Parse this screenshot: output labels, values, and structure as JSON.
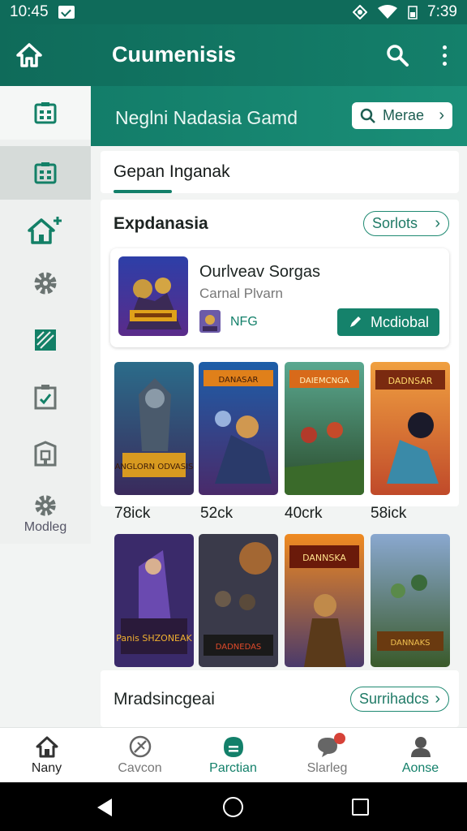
{
  "status_bar": {
    "time_left": "10:45",
    "time_right": "7:39"
  },
  "app_bar": {
    "title": "Cuumenisis",
    "icons": [
      "home-back-icon",
      "search-icon",
      "more-vert-icon"
    ]
  },
  "header": {
    "subtitle": "Neglni Nadasia Gamd",
    "more_chip_label": "Merae"
  },
  "rail": {
    "items": [
      {
        "icon": "calendar-grid-icon"
      },
      {
        "icon": "calendar-grid-icon"
      },
      {
        "icon": "home-add-icon"
      },
      {
        "icon": "gear-icon"
      },
      {
        "icon": "slash-box-icon"
      },
      {
        "icon": "checklist-icon"
      },
      {
        "icon": "building-icon"
      },
      {
        "icon": "gear-icon",
        "label": "Modleg"
      }
    ]
  },
  "tab": {
    "label": "Gepan Inganak"
  },
  "section_main": {
    "title": "Expdanasia",
    "pill_label": "Sorlots",
    "featured": {
      "title": "Ourlveav Sorgas",
      "subtitle": "Carnal Plvarn",
      "tag": "NFG",
      "button_label": "Mcdiobal"
    }
  },
  "grid": {
    "row1": [
      {
        "caption": "78ick",
        "art_title": "ANGLORN ODVASIS"
      },
      {
        "caption": "52ck",
        "art_title": "DANASAR"
      },
      {
        "caption": "40crk",
        "art_title": "DAIEMCNGA"
      },
      {
        "caption": "58ick",
        "art_title": "DADNSAR"
      }
    ],
    "row2": [
      {
        "art_title": "Panis SHZONEAK"
      },
      {
        "art_title": "DADNEDAS"
      },
      {
        "art_title": "DANNSKA"
      },
      {
        "art_title": "DANNAKS"
      }
    ]
  },
  "section_second": {
    "title": "Mradsincgeai",
    "pill_label": "Surrihadcs"
  },
  "bottom_nav": {
    "items": [
      {
        "label": "Nany",
        "icon": "home-icon"
      },
      {
        "label": "Cavcon",
        "icon": "no-entry-icon"
      },
      {
        "label": "Parctian",
        "icon": "bag-icon",
        "active": true
      },
      {
        "label": "Slarleg",
        "icon": "chat-bubble-icon"
      },
      {
        "label": "Aonse",
        "icon": "person-icon"
      }
    ]
  },
  "colors": {
    "primary": "#13806a",
    "primary_dark": "#0f6b5a",
    "surface": "#ffffff"
  }
}
